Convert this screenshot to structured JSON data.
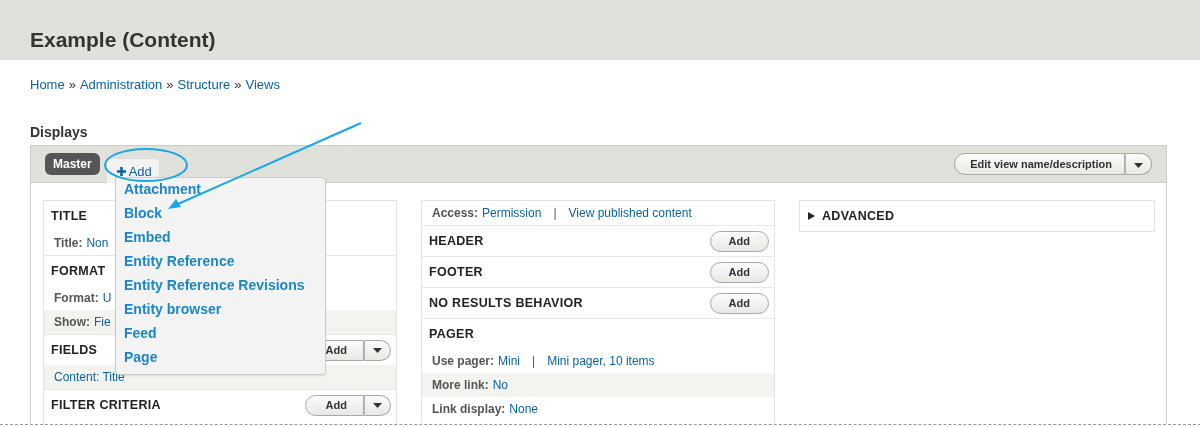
{
  "page_title": "Example (Content)",
  "breadcrumb": {
    "separator": "»",
    "items": [
      "Home",
      "Administration",
      "Structure",
      "Views"
    ]
  },
  "section_title": "Displays",
  "display_tabs": [
    {
      "label": "Master",
      "selected": true
    }
  ],
  "add_display": {
    "label": "Add",
    "expanded": true,
    "menu": [
      "Attachment",
      "Block",
      "Embed",
      "Entity Reference",
      "Entity Reference Revisions",
      "Entity browser",
      "Feed",
      "Page"
    ]
  },
  "edit_button": {
    "label": "Edit view name/description"
  },
  "columns": [
    {
      "sections": [
        {
          "title": "TITLE",
          "rows": [
            {
              "label": "Title:",
              "value": "Non",
              "shaded": false
            }
          ]
        },
        {
          "title": "FORMAT",
          "rows": [
            {
              "label": "Format:",
              "value": "U",
              "shaded": false
            },
            {
              "label": "Show:",
              "value": "Fie",
              "shaded": true
            }
          ]
        },
        {
          "title": "FIELDS",
          "button": {
            "label": "Add",
            "dropdown": true
          },
          "rows": [
            {
              "value": "Content: Title",
              "shaded": true
            }
          ]
        },
        {
          "title": "FILTER CRITERIA",
          "button": {
            "label": "Add",
            "dropdown": true
          }
        }
      ]
    },
    {
      "sections": [
        {
          "rows": [
            {
              "label": "Access:",
              "value": "Permission",
              "extra": "View published content",
              "separator": "|",
              "shaded": false
            }
          ]
        },
        {
          "title": "HEADER",
          "button": {
            "label": "Add",
            "dropdown": false
          }
        },
        {
          "title": "FOOTER",
          "button": {
            "label": "Add",
            "dropdown": false
          }
        },
        {
          "title": "NO RESULTS BEHAVIOR",
          "button": {
            "label": "Add",
            "dropdown": false
          }
        },
        {
          "title": "PAGER",
          "rows": [
            {
              "label": "Use pager:",
              "value": "Mini",
              "extra": "Mini pager, 10 items",
              "separator": "|",
              "shaded": false
            },
            {
              "label": "More link:",
              "value": "No",
              "shaded": true
            },
            {
              "label": "Link display:",
              "value": "None",
              "shaded": false
            }
          ]
        }
      ]
    }
  ],
  "advanced": {
    "label": "ADVANCED",
    "expanded": false
  }
}
